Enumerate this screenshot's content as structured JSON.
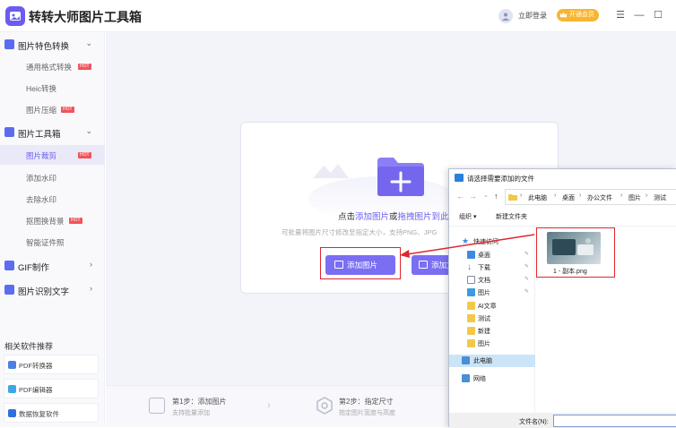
{
  "app": {
    "title": "转转大师图片工具箱",
    "login": "立即登录",
    "vip": "开通会员"
  },
  "window": {
    "menu": "☰",
    "minimize": "—",
    "maximize": "☐"
  },
  "sidebar": {
    "categories": [
      {
        "label": "图片特色转换",
        "arrow": "⌄",
        "items": [
          {
            "label": "通用格式转换",
            "hot": "HOT"
          },
          {
            "label": "Heic转换",
            "hot": ""
          },
          {
            "label": "图片压缩",
            "hot": "HOT"
          }
        ]
      },
      {
        "label": "图片工具箱",
        "arrow": "⌄",
        "items": [
          {
            "label": "图片裁剪",
            "hot": "HOT"
          },
          {
            "label": "添加水印",
            "hot": ""
          },
          {
            "label": "去除水印",
            "hot": ""
          },
          {
            "label": "抠图换背景",
            "hot": "HOT"
          },
          {
            "label": "智能证件照",
            "hot": ""
          }
        ]
      },
      {
        "label": "GIF制作",
        "arrow": "›"
      },
      {
        "label": "图片识别文字",
        "arrow": "›"
      }
    ],
    "recommend_title": "相关软件推荐",
    "recommend": [
      "PDF转换器",
      "PDF编辑器",
      "数据恢复软件"
    ]
  },
  "dropzone": {
    "text_prefix": "点击",
    "link1": "添加图片",
    "text_mid": "或",
    "link2": "拖拽图片到此",
    "sub": "可批量将图片尺寸修改至指定大小，支持PNG、JPG",
    "btn_add": "添加图片",
    "btn_add_folder": "添加文件夹"
  },
  "steps": [
    {
      "title": "第1步：添加图片",
      "desc": "支持批量添加"
    },
    {
      "title": "第2步：指定尺寸",
      "desc": "指定图片宽度与高度"
    }
  ],
  "dialog": {
    "title": "请选择需要添加的文件",
    "nav": {
      "back": "←",
      "forward": "→",
      "down": "⌄",
      "up": "↑"
    },
    "breadcrumb": [
      "此电脑",
      "桌面",
      "办公文件",
      "图片",
      "测试"
    ],
    "toolbar": {
      "organize": "组织 ▾",
      "new_folder": "新建文件夹"
    },
    "nav_pane": [
      {
        "label": "快速访问",
        "pinned": false,
        "color": "#3b8be0"
      },
      {
        "label": "桌面",
        "pinned": true,
        "color": "#3b8be0"
      },
      {
        "label": "下载",
        "pinned": true,
        "color": "#2b78d0"
      },
      {
        "label": "文档",
        "pinned": true,
        "color": "#7d8ea3"
      },
      {
        "label": "图片",
        "pinned": true,
        "color": "#3d9be0"
      },
      {
        "label": "AI文章",
        "pinned": false,
        "color": "#f3c84a"
      },
      {
        "label": "测试",
        "pinned": false,
        "color": "#f3c84a"
      },
      {
        "label": "新建",
        "pinned": false,
        "color": "#f3c84a"
      },
      {
        "label": "图片",
        "pinned": false,
        "color": "#f3c84a"
      },
      {
        "label": "此电脑",
        "pinned": false,
        "color": "#4a8fd6"
      },
      {
        "label": "网络",
        "pinned": false,
        "color": "#4a8fd6"
      }
    ],
    "file": "1 - 副本.png",
    "filename_label": "文件名(N):",
    "filename_value": ""
  }
}
